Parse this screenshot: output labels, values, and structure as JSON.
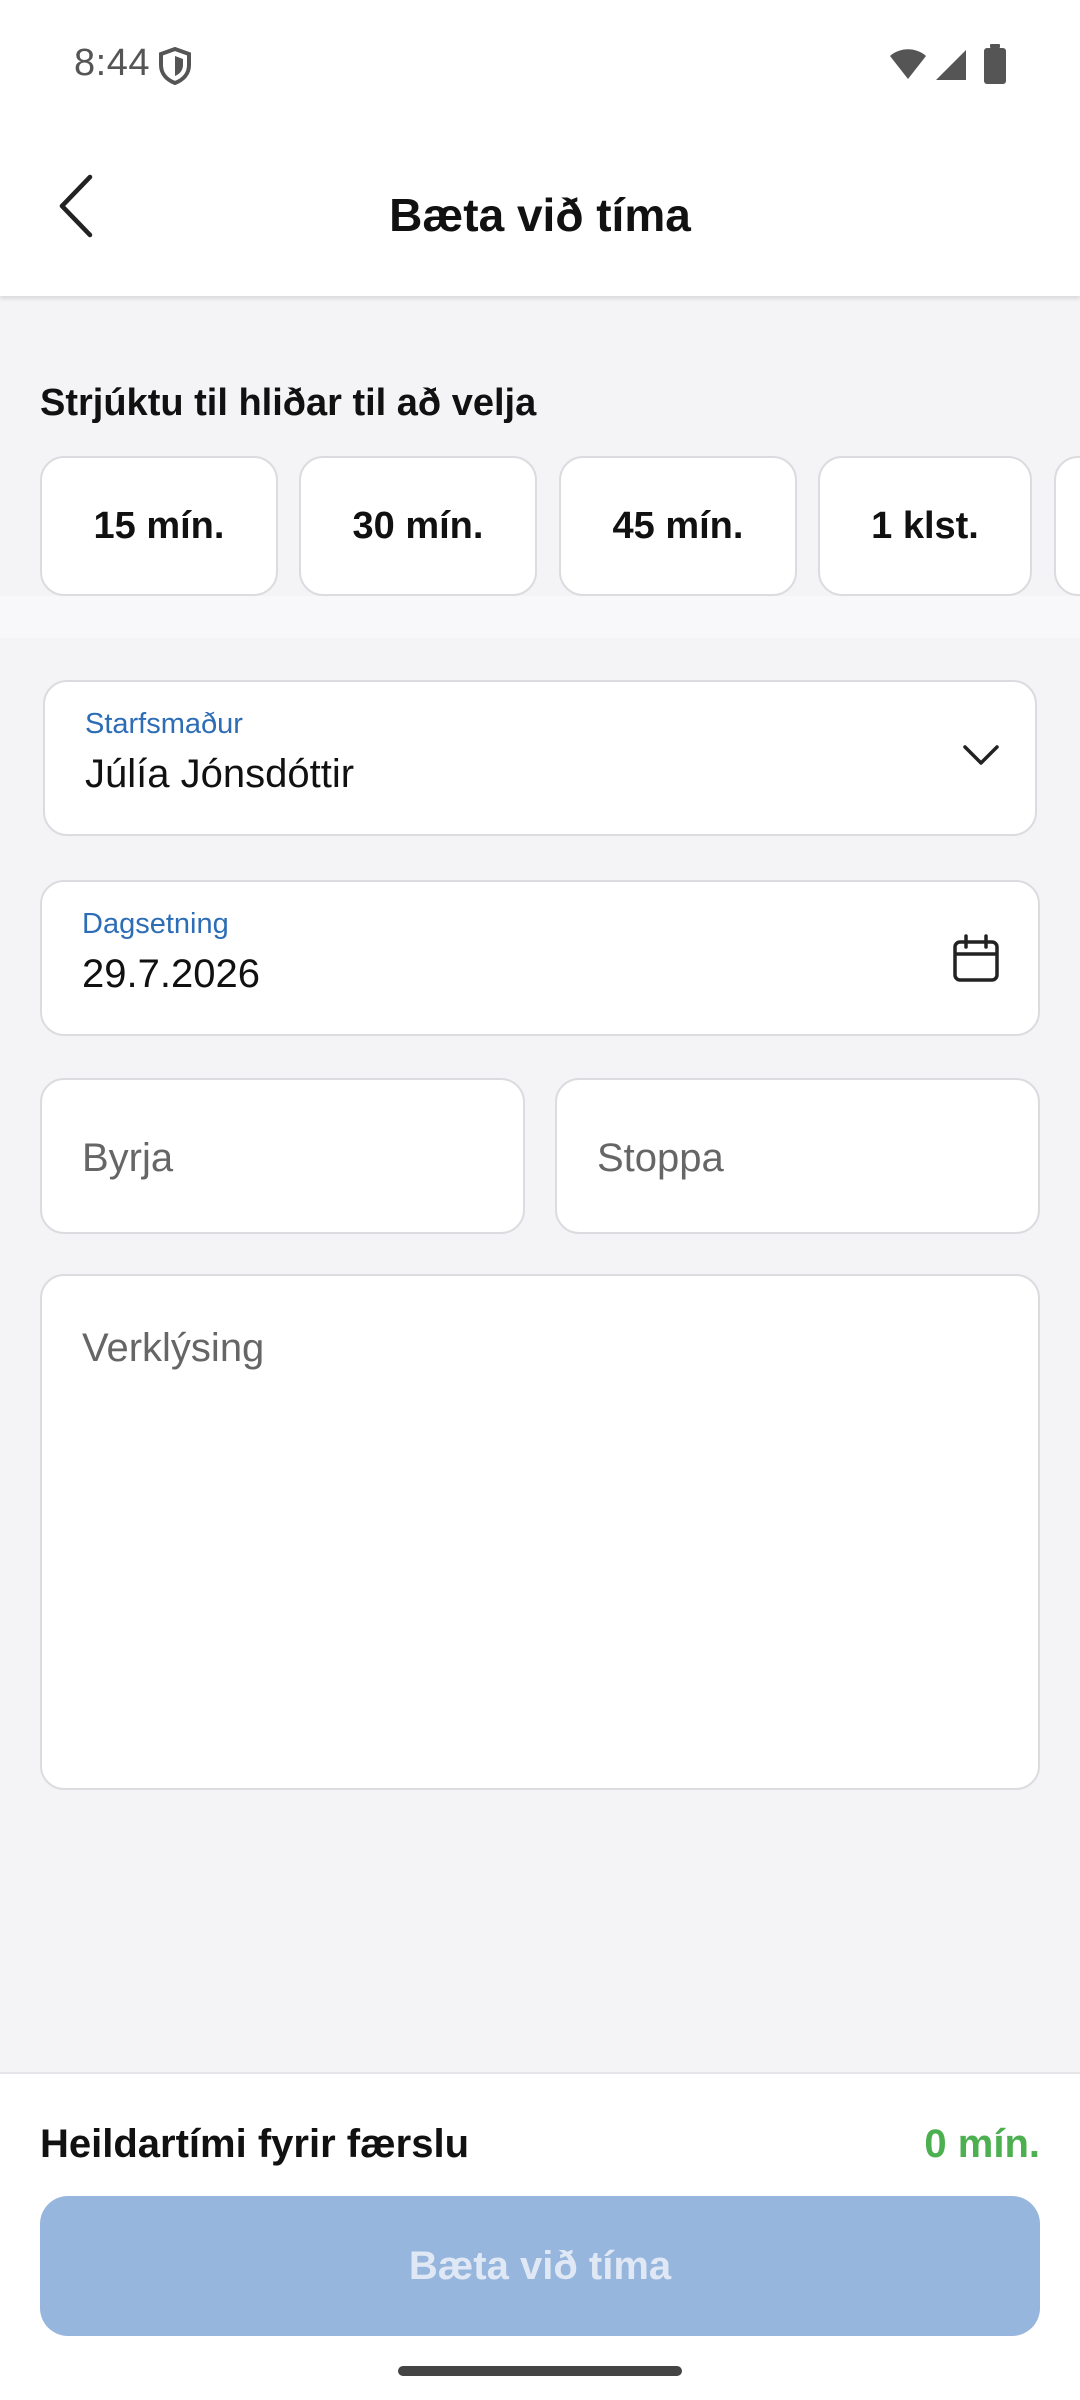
{
  "status_bar": {
    "time": "8:44",
    "icons": [
      "shield-icon",
      "wifi-icon",
      "signal-icon",
      "battery-icon"
    ]
  },
  "app_bar": {
    "back_icon": "chevron-left-icon",
    "title": "Bæta við tíma"
  },
  "quick_select": {
    "label": "Strjúktu til hliðar til að velja",
    "chips": [
      "15 mín.",
      "30 mín.",
      "45 mín.",
      "1 klst."
    ]
  },
  "form": {
    "employee": {
      "label": "Starfsmaður",
      "value": "Júlía Jónsdóttir",
      "icon": "chevron-down-icon"
    },
    "date": {
      "label": "Dagsetning",
      "value": "29.7.2026",
      "icon": "calendar-icon"
    },
    "start": {
      "placeholder": "Byrja"
    },
    "stop": {
      "placeholder": "Stoppa"
    },
    "description": {
      "placeholder": "Verklýsing"
    }
  },
  "footer": {
    "total_label": "Heildartími fyrir færslu",
    "total_value": "0 mín.",
    "submit_label": "Bæta við tíma"
  },
  "colors": {
    "accent_label": "#2d6db5",
    "total_green": "#4caf50",
    "disabled_button": "#97b6dd"
  }
}
